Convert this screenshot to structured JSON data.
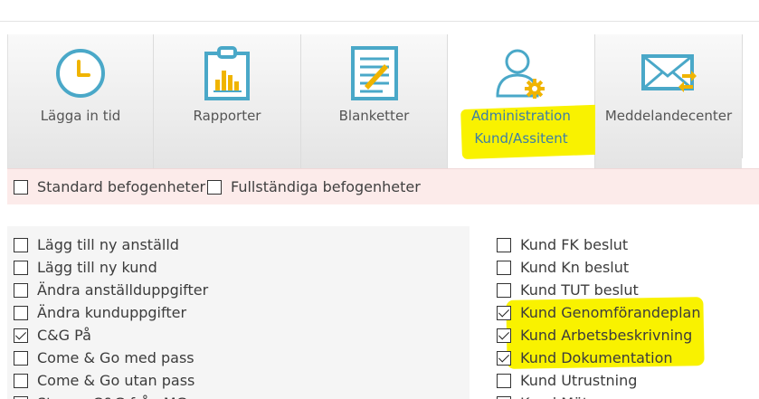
{
  "tabs": [
    {
      "label": "Lägga in tid",
      "icon": "clock-icon"
    },
    {
      "label": "Rapporter",
      "icon": "clipboard-chart-icon"
    },
    {
      "label": "Blanketter",
      "icon": "form-pencil-icon"
    },
    {
      "label_line1": "Administration",
      "label_line2": "Kund/Assitent",
      "icon": "user-gear-icon",
      "active": true
    },
    {
      "label": "Meddelandecenter",
      "icon": "envelope-arrows-icon"
    }
  ],
  "permissions_band": {
    "standard_label": "Standard befogenheter",
    "full_label": "Fullständiga befogenheter"
  },
  "left_list": [
    {
      "label": "Lägg till ny anställd",
      "checked": false
    },
    {
      "label": "Lägg till ny kund",
      "checked": false
    },
    {
      "label": "Ändra anställduppgifter",
      "checked": false
    },
    {
      "label": "Ändra kunduppgifter",
      "checked": false
    },
    {
      "label": "C&G På",
      "checked": true
    },
    {
      "label": "Come & Go med pass",
      "checked": false
    },
    {
      "label": "Come & Go utan pass",
      "checked": false
    },
    {
      "label": "Stoppa C&G från MG",
      "checked": false
    }
  ],
  "right_list": [
    {
      "label": "Kund FK beslut",
      "checked": false
    },
    {
      "label": "Kund Kn beslut",
      "checked": false
    },
    {
      "label": "Kund TUT beslut",
      "checked": false
    },
    {
      "label": "Kund Genomförandeplan",
      "checked": true
    },
    {
      "label": "Kund Arbetsbeskrivning",
      "checked": true
    },
    {
      "label": "Kund Dokumentation",
      "checked": true
    },
    {
      "label": "Kund Utrustning",
      "checked": false
    },
    {
      "label": "Kund Möten",
      "checked": false
    }
  ],
  "colors": {
    "icon_teal": "#4aa8c8",
    "icon_gold": "#f0b400",
    "highlight": "#f9f200",
    "band_pink": "#fcebea"
  }
}
